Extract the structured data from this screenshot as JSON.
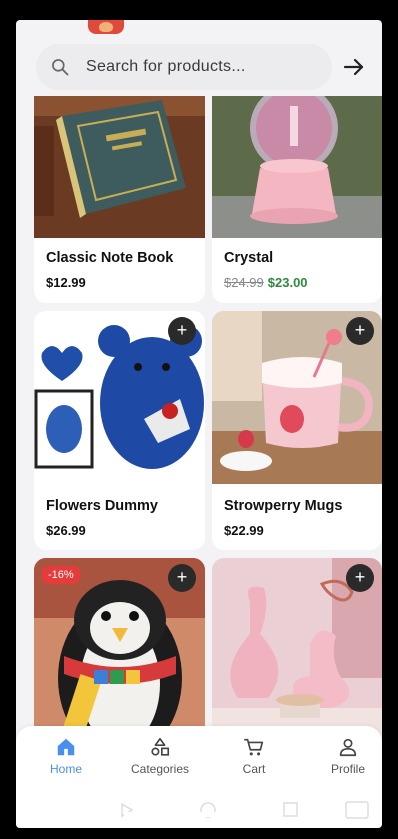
{
  "search": {
    "placeholder": "Search for products..."
  },
  "products": [
    {
      "name": "Classic Note Book",
      "price": "$12.99"
    },
    {
      "name": "Crystal",
      "old_price": "$24.99",
      "price": "$23.00"
    },
    {
      "name": "Flowers Dummy",
      "price": "$26.99"
    },
    {
      "name": "Strowperry Mugs",
      "price": "$22.99"
    },
    {
      "badge": "-16%"
    },
    {}
  ],
  "nav": {
    "home": "Home",
    "categories": "Categories",
    "cart": "Cart",
    "profile": "Profile"
  },
  "colors": {
    "accent": "#4a8ff0",
    "sale_price": "#2e8b3d",
    "badge": "#e63b3b"
  }
}
